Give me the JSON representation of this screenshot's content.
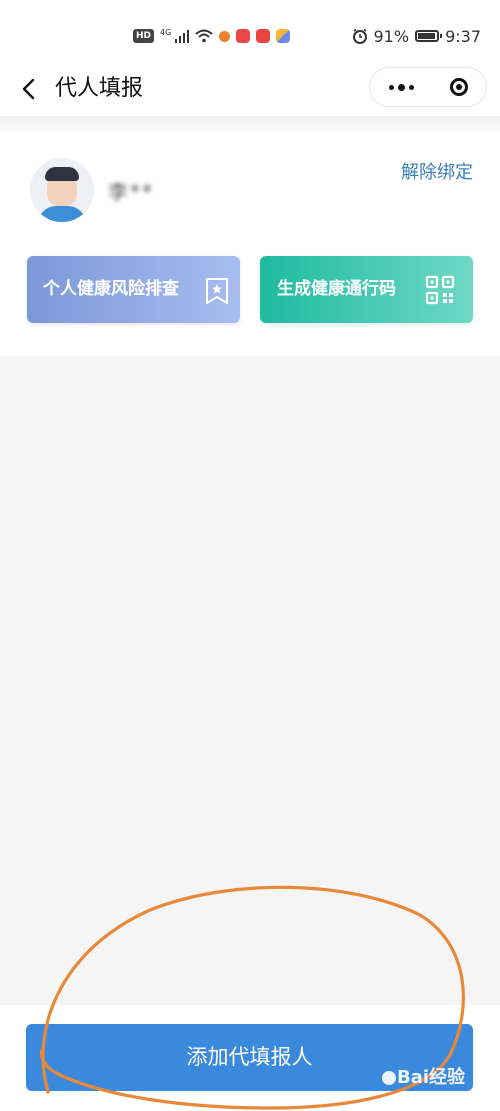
{
  "status_bar": {
    "network_badge": "HD",
    "network_type": "4G",
    "battery": "91%",
    "time": "9:37",
    "app_icon_colors": [
      "#f07e32",
      "#e84848",
      "#e8463c",
      "#6a8af0"
    ]
  },
  "nav": {
    "back_icon": "chevron-left-icon",
    "title": "代人填报",
    "more_icon": "more-dots-icon",
    "close_icon": "target-circle-icon"
  },
  "profile": {
    "name": "李**",
    "unbind_label": "解除绑定"
  },
  "actions": [
    {
      "label": "个人健康风险排查",
      "icon": "bookmark-star-icon",
      "color": "#8fa6e6"
    },
    {
      "label": "生成健康通行码",
      "icon": "qr-code-icon",
      "color": "#25c0a8"
    }
  ],
  "footer": {
    "add_label": "添加代填报人",
    "color": "#3b89dd"
  },
  "overlay": {
    "annotation": "hand-drawn-orange-circle",
    "annotation_color": "#e8893a",
    "watermark": "Bai经验",
    "watermark_icon": "paw-icon"
  }
}
